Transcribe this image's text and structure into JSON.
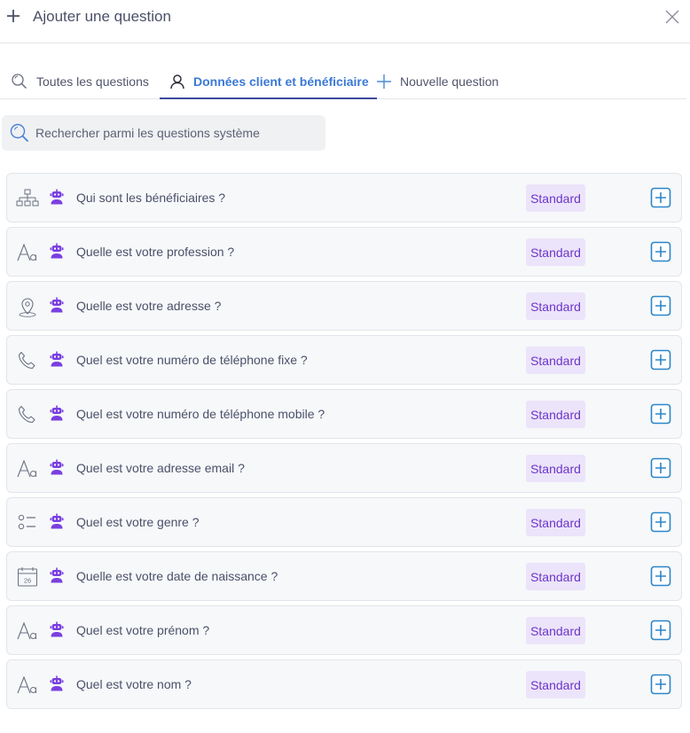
{
  "header": {
    "title": "Ajouter une question"
  },
  "tabs": [
    {
      "label": "Toutes les questions",
      "icon": "search-icon"
    },
    {
      "label": "Données client et bénéficiaire",
      "icon": "user-icon",
      "active": true
    },
    {
      "label": "Nouvelle question",
      "icon": "plus-icon"
    }
  ],
  "search": {
    "placeholder": "Rechercher parmi les questions système",
    "value": ""
  },
  "questions": [
    {
      "text": "Qui sont les bénéficiaires ?",
      "type_icon": "hierarchy-icon",
      "badge": "Standard"
    },
    {
      "text": "Quelle est votre profession ?",
      "type_icon": "text-icon",
      "badge": "Standard"
    },
    {
      "text": "Quelle est votre adresse ?",
      "type_icon": "location-pin-icon",
      "badge": "Standard"
    },
    {
      "text": "Quel est votre numéro de téléphone fixe ?",
      "type_icon": "phone-icon",
      "badge": "Standard"
    },
    {
      "text": "Quel est votre numéro de téléphone mobile ?",
      "type_icon": "phone-icon",
      "badge": "Standard"
    },
    {
      "text": "Quel est votre adresse email ?",
      "type_icon": "text-icon",
      "badge": "Standard"
    },
    {
      "text": "Quel est votre genre ?",
      "type_icon": "radio-list-icon",
      "badge": "Standard"
    },
    {
      "text": "Quelle est votre date de naissance ?",
      "type_icon": "calendar-icon",
      "badge": "Standard",
      "calendar_day": "26"
    },
    {
      "text": "Quel est votre prénom ?",
      "type_icon": "text-icon",
      "badge": "Standard"
    },
    {
      "text": "Quel est votre nom ?",
      "type_icon": "text-icon",
      "badge": "Standard"
    }
  ],
  "colors": {
    "accent_blue": "#3a79d6",
    "badge_bg": "#ece4fa",
    "badge_text": "#6d35c9",
    "bot_purple": "#7a3fe0",
    "row_bg": "#f6f8fa"
  }
}
